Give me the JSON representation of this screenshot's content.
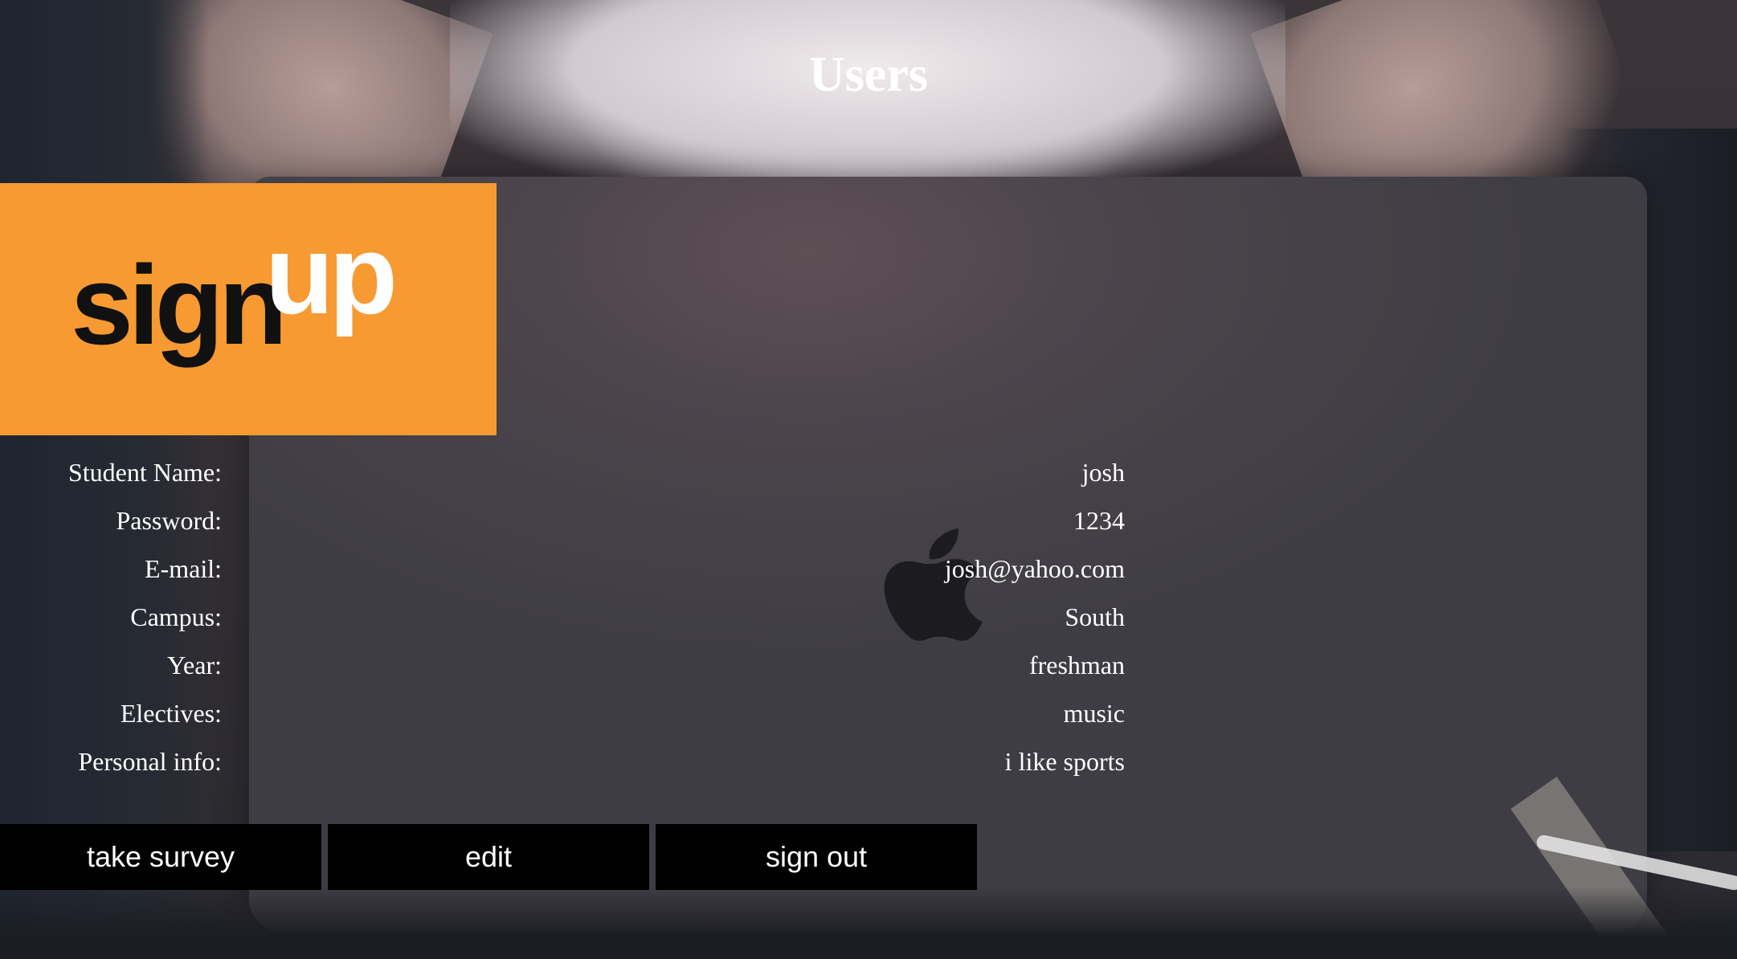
{
  "page": {
    "title": "Users"
  },
  "logo": {
    "text_dark": "sign",
    "text_light": "up",
    "background_color": "#f79a32"
  },
  "profile": {
    "rows": [
      {
        "label": "Student Name:",
        "value": "josh"
      },
      {
        "label": "Password:",
        "value": "1234"
      },
      {
        "label": "E-mail:",
        "value": "josh@yahoo.com"
      },
      {
        "label": "Campus:",
        "value": "South"
      },
      {
        "label": "Year:",
        "value": "freshman"
      },
      {
        "label": "Electives:",
        "value": "music"
      },
      {
        "label": "Personal info:",
        "value": "i like sports"
      }
    ]
  },
  "actions": {
    "take_survey": "take survey",
    "edit": "edit",
    "sign_out": "sign out"
  },
  "colors": {
    "button_bg": "#000000",
    "button_text": "#ffffff",
    "text": "#ffffff"
  }
}
